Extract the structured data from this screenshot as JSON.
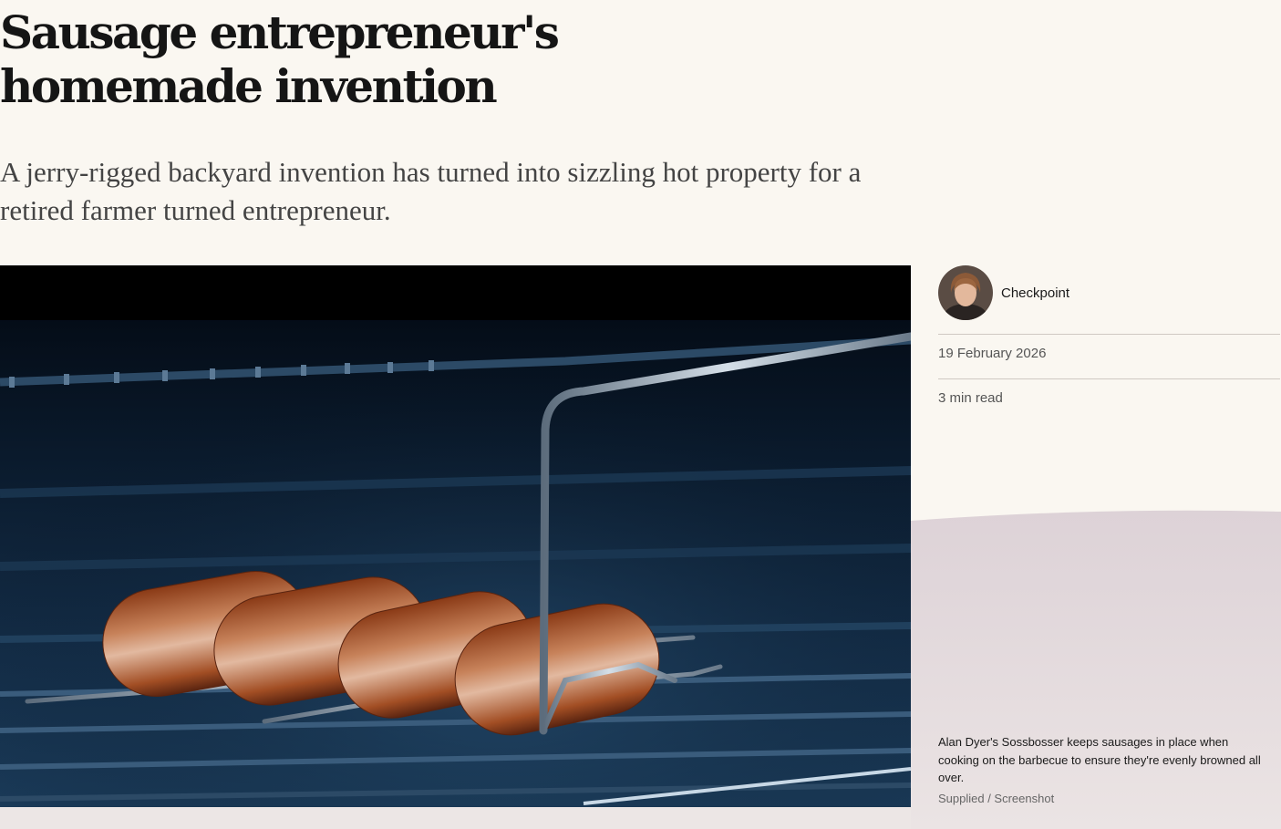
{
  "article": {
    "headline": "Sausage entrepreneur's homemade invention",
    "standfirst": "A jerry-rigged backyard invention has turned into sizzling hot property for a retired farmer turned entrepreneur."
  },
  "byline": {
    "author": "Checkpoint",
    "date": "19 February 2026",
    "read_time": "3 min read"
  },
  "hero_image": {
    "caption": "Alan Dyer's Sossbosser keeps sausages in place when cooking on the barbecue to ensure they're evenly browned all over.",
    "credit": "Supplied / Screenshot"
  },
  "colors": {
    "page_background": "#faf7f1",
    "caption_panel": "#e2d7da",
    "footer_strip": "#ece6e5"
  }
}
